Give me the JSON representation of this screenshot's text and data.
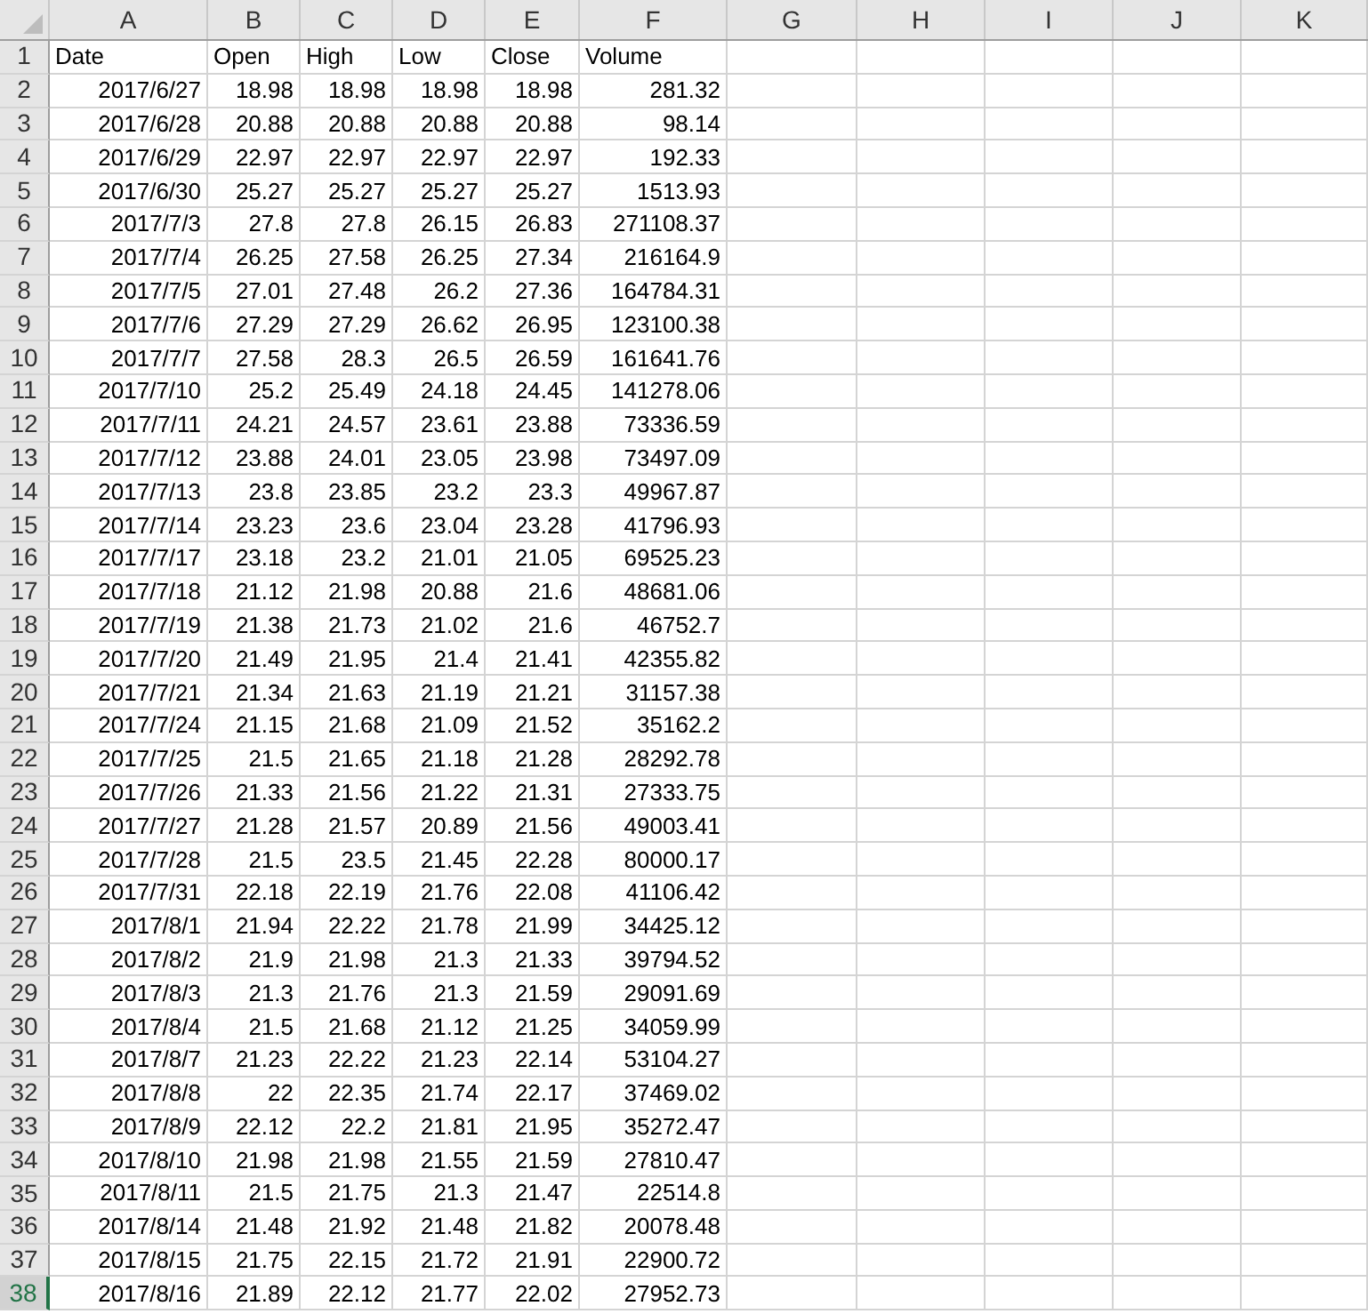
{
  "columns": [
    "A",
    "B",
    "C",
    "D",
    "E",
    "F",
    "G",
    "H",
    "I",
    "J",
    "K"
  ],
  "rows": [
    {
      "number": "1",
      "kind": "text",
      "selected": false,
      "cells": [
        "Date",
        "Open",
        "High",
        "Low",
        "Close",
        "Volume"
      ]
    },
    {
      "number": "2",
      "kind": "number",
      "selected": false,
      "cells": [
        "2017/6/27",
        "18.98",
        "18.98",
        "18.98",
        "18.98",
        "281.32"
      ]
    },
    {
      "number": "3",
      "kind": "number",
      "selected": false,
      "cells": [
        "2017/6/28",
        "20.88",
        "20.88",
        "20.88",
        "20.88",
        "98.14"
      ]
    },
    {
      "number": "4",
      "kind": "number",
      "selected": false,
      "cells": [
        "2017/6/29",
        "22.97",
        "22.97",
        "22.97",
        "22.97",
        "192.33"
      ]
    },
    {
      "number": "5",
      "kind": "number",
      "selected": false,
      "cells": [
        "2017/6/30",
        "25.27",
        "25.27",
        "25.27",
        "25.27",
        "1513.93"
      ]
    },
    {
      "number": "6",
      "kind": "number",
      "selected": false,
      "cells": [
        "2017/7/3",
        "27.8",
        "27.8",
        "26.15",
        "26.83",
        "271108.37"
      ]
    },
    {
      "number": "7",
      "kind": "number",
      "selected": false,
      "cells": [
        "2017/7/4",
        "26.25",
        "27.58",
        "26.25",
        "27.34",
        "216164.9"
      ]
    },
    {
      "number": "8",
      "kind": "number",
      "selected": false,
      "cells": [
        "2017/7/5",
        "27.01",
        "27.48",
        "26.2",
        "27.36",
        "164784.31"
      ]
    },
    {
      "number": "9",
      "kind": "number",
      "selected": false,
      "cells": [
        "2017/7/6",
        "27.29",
        "27.29",
        "26.62",
        "26.95",
        "123100.38"
      ]
    },
    {
      "number": "10",
      "kind": "number",
      "selected": false,
      "cells": [
        "2017/7/7",
        "27.58",
        "28.3",
        "26.5",
        "26.59",
        "161641.76"
      ]
    },
    {
      "number": "11",
      "kind": "number",
      "selected": false,
      "cells": [
        "2017/7/10",
        "25.2",
        "25.49",
        "24.18",
        "24.45",
        "141278.06"
      ]
    },
    {
      "number": "12",
      "kind": "number",
      "selected": false,
      "cells": [
        "2017/7/11",
        "24.21",
        "24.57",
        "23.61",
        "23.88",
        "73336.59"
      ]
    },
    {
      "number": "13",
      "kind": "number",
      "selected": false,
      "cells": [
        "2017/7/12",
        "23.88",
        "24.01",
        "23.05",
        "23.98",
        "73497.09"
      ]
    },
    {
      "number": "14",
      "kind": "number",
      "selected": false,
      "cells": [
        "2017/7/13",
        "23.8",
        "23.85",
        "23.2",
        "23.3",
        "49967.87"
      ]
    },
    {
      "number": "15",
      "kind": "number",
      "selected": false,
      "cells": [
        "2017/7/14",
        "23.23",
        "23.6",
        "23.04",
        "23.28",
        "41796.93"
      ]
    },
    {
      "number": "16",
      "kind": "number",
      "selected": false,
      "cells": [
        "2017/7/17",
        "23.18",
        "23.2",
        "21.01",
        "21.05",
        "69525.23"
      ]
    },
    {
      "number": "17",
      "kind": "number",
      "selected": false,
      "cells": [
        "2017/7/18",
        "21.12",
        "21.98",
        "20.88",
        "21.6",
        "48681.06"
      ]
    },
    {
      "number": "18",
      "kind": "number",
      "selected": false,
      "cells": [
        "2017/7/19",
        "21.38",
        "21.73",
        "21.02",
        "21.6",
        "46752.7"
      ]
    },
    {
      "number": "19",
      "kind": "number",
      "selected": false,
      "cells": [
        "2017/7/20",
        "21.49",
        "21.95",
        "21.4",
        "21.41",
        "42355.82"
      ]
    },
    {
      "number": "20",
      "kind": "number",
      "selected": false,
      "cells": [
        "2017/7/21",
        "21.34",
        "21.63",
        "21.19",
        "21.21",
        "31157.38"
      ]
    },
    {
      "number": "21",
      "kind": "number",
      "selected": false,
      "cells": [
        "2017/7/24",
        "21.15",
        "21.68",
        "21.09",
        "21.52",
        "35162.2"
      ]
    },
    {
      "number": "22",
      "kind": "number",
      "selected": false,
      "cells": [
        "2017/7/25",
        "21.5",
        "21.65",
        "21.18",
        "21.28",
        "28292.78"
      ]
    },
    {
      "number": "23",
      "kind": "number",
      "selected": false,
      "cells": [
        "2017/7/26",
        "21.33",
        "21.56",
        "21.22",
        "21.31",
        "27333.75"
      ]
    },
    {
      "number": "24",
      "kind": "number",
      "selected": false,
      "cells": [
        "2017/7/27",
        "21.28",
        "21.57",
        "20.89",
        "21.56",
        "49003.41"
      ]
    },
    {
      "number": "25",
      "kind": "number",
      "selected": false,
      "cells": [
        "2017/7/28",
        "21.5",
        "23.5",
        "21.45",
        "22.28",
        "80000.17"
      ]
    },
    {
      "number": "26",
      "kind": "number",
      "selected": false,
      "cells": [
        "2017/7/31",
        "22.18",
        "22.19",
        "21.76",
        "22.08",
        "41106.42"
      ]
    },
    {
      "number": "27",
      "kind": "number",
      "selected": false,
      "cells": [
        "2017/8/1",
        "21.94",
        "22.22",
        "21.78",
        "21.99",
        "34425.12"
      ]
    },
    {
      "number": "28",
      "kind": "number",
      "selected": false,
      "cells": [
        "2017/8/2",
        "21.9",
        "21.98",
        "21.3",
        "21.33",
        "39794.52"
      ]
    },
    {
      "number": "29",
      "kind": "number",
      "selected": false,
      "cells": [
        "2017/8/3",
        "21.3",
        "21.76",
        "21.3",
        "21.59",
        "29091.69"
      ]
    },
    {
      "number": "30",
      "kind": "number",
      "selected": false,
      "cells": [
        "2017/8/4",
        "21.5",
        "21.68",
        "21.12",
        "21.25",
        "34059.99"
      ]
    },
    {
      "number": "31",
      "kind": "number",
      "selected": false,
      "cells": [
        "2017/8/7",
        "21.23",
        "22.22",
        "21.23",
        "22.14",
        "53104.27"
      ]
    },
    {
      "number": "32",
      "kind": "number",
      "selected": false,
      "cells": [
        "2017/8/8",
        "22",
        "22.35",
        "21.74",
        "22.17",
        "37469.02"
      ]
    },
    {
      "number": "33",
      "kind": "number",
      "selected": false,
      "cells": [
        "2017/8/9",
        "22.12",
        "22.2",
        "21.81",
        "21.95",
        "35272.47"
      ]
    },
    {
      "number": "34",
      "kind": "number",
      "selected": false,
      "cells": [
        "2017/8/10",
        "21.98",
        "21.98",
        "21.55",
        "21.59",
        "27810.47"
      ]
    },
    {
      "number": "35",
      "kind": "number",
      "selected": false,
      "cells": [
        "2017/8/11",
        "21.5",
        "21.75",
        "21.3",
        "21.47",
        "22514.8"
      ]
    },
    {
      "number": "36",
      "kind": "number",
      "selected": false,
      "cells": [
        "2017/8/14",
        "21.48",
        "21.92",
        "21.48",
        "21.82",
        "20078.48"
      ]
    },
    {
      "number": "37",
      "kind": "number",
      "selected": false,
      "cells": [
        "2017/8/15",
        "21.75",
        "22.15",
        "21.72",
        "21.91",
        "22900.72"
      ]
    },
    {
      "number": "38",
      "kind": "number",
      "selected": true,
      "cells": [
        "2017/8/16",
        "21.89",
        "22.12",
        "21.77",
        "22.02",
        "27952.73"
      ]
    }
  ]
}
